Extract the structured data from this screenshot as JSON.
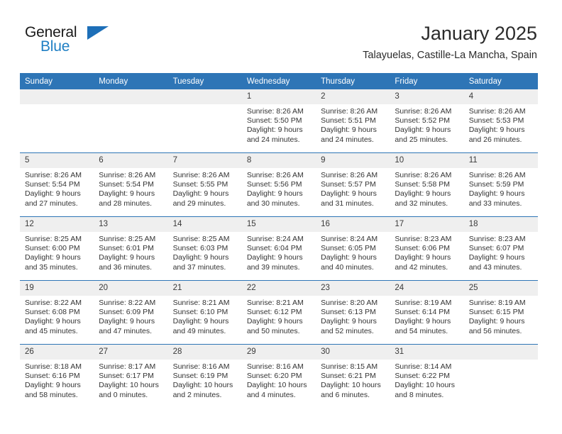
{
  "brand": {
    "name_part1": "General",
    "name_part2": "Blue",
    "logo_icon": "triangle-flag-icon",
    "accent_color": "#1d6fb8"
  },
  "header": {
    "title": "January 2025",
    "subtitle": "Talayuelas, Castille-La Mancha, Spain"
  },
  "theme": {
    "header_row_bg": "#2e75b6",
    "day_number_bg": "#efefef",
    "row_divider": "#2e75b6",
    "text": "#333333"
  },
  "calendar": {
    "weekday_headers": [
      "Sunday",
      "Monday",
      "Tuesday",
      "Wednesday",
      "Thursday",
      "Friday",
      "Saturday"
    ],
    "weeks": [
      [
        {
          "day": "",
          "lines": []
        },
        {
          "day": "",
          "lines": []
        },
        {
          "day": "",
          "lines": []
        },
        {
          "day": "1",
          "lines": [
            "Sunrise: 8:26 AM",
            "Sunset: 5:50 PM",
            "Daylight: 9 hours",
            "and 24 minutes."
          ]
        },
        {
          "day": "2",
          "lines": [
            "Sunrise: 8:26 AM",
            "Sunset: 5:51 PM",
            "Daylight: 9 hours",
            "and 24 minutes."
          ]
        },
        {
          "day": "3",
          "lines": [
            "Sunrise: 8:26 AM",
            "Sunset: 5:52 PM",
            "Daylight: 9 hours",
            "and 25 minutes."
          ]
        },
        {
          "day": "4",
          "lines": [
            "Sunrise: 8:26 AM",
            "Sunset: 5:53 PM",
            "Daylight: 9 hours",
            "and 26 minutes."
          ]
        }
      ],
      [
        {
          "day": "5",
          "lines": [
            "Sunrise: 8:26 AM",
            "Sunset: 5:54 PM",
            "Daylight: 9 hours",
            "and 27 minutes."
          ]
        },
        {
          "day": "6",
          "lines": [
            "Sunrise: 8:26 AM",
            "Sunset: 5:54 PM",
            "Daylight: 9 hours",
            "and 28 minutes."
          ]
        },
        {
          "day": "7",
          "lines": [
            "Sunrise: 8:26 AM",
            "Sunset: 5:55 PM",
            "Daylight: 9 hours",
            "and 29 minutes."
          ]
        },
        {
          "day": "8",
          "lines": [
            "Sunrise: 8:26 AM",
            "Sunset: 5:56 PM",
            "Daylight: 9 hours",
            "and 30 minutes."
          ]
        },
        {
          "day": "9",
          "lines": [
            "Sunrise: 8:26 AM",
            "Sunset: 5:57 PM",
            "Daylight: 9 hours",
            "and 31 minutes."
          ]
        },
        {
          "day": "10",
          "lines": [
            "Sunrise: 8:26 AM",
            "Sunset: 5:58 PM",
            "Daylight: 9 hours",
            "and 32 minutes."
          ]
        },
        {
          "day": "11",
          "lines": [
            "Sunrise: 8:26 AM",
            "Sunset: 5:59 PM",
            "Daylight: 9 hours",
            "and 33 minutes."
          ]
        }
      ],
      [
        {
          "day": "12",
          "lines": [
            "Sunrise: 8:25 AM",
            "Sunset: 6:00 PM",
            "Daylight: 9 hours",
            "and 35 minutes."
          ]
        },
        {
          "day": "13",
          "lines": [
            "Sunrise: 8:25 AM",
            "Sunset: 6:01 PM",
            "Daylight: 9 hours",
            "and 36 minutes."
          ]
        },
        {
          "day": "14",
          "lines": [
            "Sunrise: 8:25 AM",
            "Sunset: 6:03 PM",
            "Daylight: 9 hours",
            "and 37 minutes."
          ]
        },
        {
          "day": "15",
          "lines": [
            "Sunrise: 8:24 AM",
            "Sunset: 6:04 PM",
            "Daylight: 9 hours",
            "and 39 minutes."
          ]
        },
        {
          "day": "16",
          "lines": [
            "Sunrise: 8:24 AM",
            "Sunset: 6:05 PM",
            "Daylight: 9 hours",
            "and 40 minutes."
          ]
        },
        {
          "day": "17",
          "lines": [
            "Sunrise: 8:23 AM",
            "Sunset: 6:06 PM",
            "Daylight: 9 hours",
            "and 42 minutes."
          ]
        },
        {
          "day": "18",
          "lines": [
            "Sunrise: 8:23 AM",
            "Sunset: 6:07 PM",
            "Daylight: 9 hours",
            "and 43 minutes."
          ]
        }
      ],
      [
        {
          "day": "19",
          "lines": [
            "Sunrise: 8:22 AM",
            "Sunset: 6:08 PM",
            "Daylight: 9 hours",
            "and 45 minutes."
          ]
        },
        {
          "day": "20",
          "lines": [
            "Sunrise: 8:22 AM",
            "Sunset: 6:09 PM",
            "Daylight: 9 hours",
            "and 47 minutes."
          ]
        },
        {
          "day": "21",
          "lines": [
            "Sunrise: 8:21 AM",
            "Sunset: 6:10 PM",
            "Daylight: 9 hours",
            "and 49 minutes."
          ]
        },
        {
          "day": "22",
          "lines": [
            "Sunrise: 8:21 AM",
            "Sunset: 6:12 PM",
            "Daylight: 9 hours",
            "and 50 minutes."
          ]
        },
        {
          "day": "23",
          "lines": [
            "Sunrise: 8:20 AM",
            "Sunset: 6:13 PM",
            "Daylight: 9 hours",
            "and 52 minutes."
          ]
        },
        {
          "day": "24",
          "lines": [
            "Sunrise: 8:19 AM",
            "Sunset: 6:14 PM",
            "Daylight: 9 hours",
            "and 54 minutes."
          ]
        },
        {
          "day": "25",
          "lines": [
            "Sunrise: 8:19 AM",
            "Sunset: 6:15 PM",
            "Daylight: 9 hours",
            "and 56 minutes."
          ]
        }
      ],
      [
        {
          "day": "26",
          "lines": [
            "Sunrise: 8:18 AM",
            "Sunset: 6:16 PM",
            "Daylight: 9 hours",
            "and 58 minutes."
          ]
        },
        {
          "day": "27",
          "lines": [
            "Sunrise: 8:17 AM",
            "Sunset: 6:17 PM",
            "Daylight: 10 hours",
            "and 0 minutes."
          ]
        },
        {
          "day": "28",
          "lines": [
            "Sunrise: 8:16 AM",
            "Sunset: 6:19 PM",
            "Daylight: 10 hours",
            "and 2 minutes."
          ]
        },
        {
          "day": "29",
          "lines": [
            "Sunrise: 8:16 AM",
            "Sunset: 6:20 PM",
            "Daylight: 10 hours",
            "and 4 minutes."
          ]
        },
        {
          "day": "30",
          "lines": [
            "Sunrise: 8:15 AM",
            "Sunset: 6:21 PM",
            "Daylight: 10 hours",
            "and 6 minutes."
          ]
        },
        {
          "day": "31",
          "lines": [
            "Sunrise: 8:14 AM",
            "Sunset: 6:22 PM",
            "Daylight: 10 hours",
            "and 8 minutes."
          ]
        },
        {
          "day": "",
          "lines": []
        }
      ]
    ]
  }
}
